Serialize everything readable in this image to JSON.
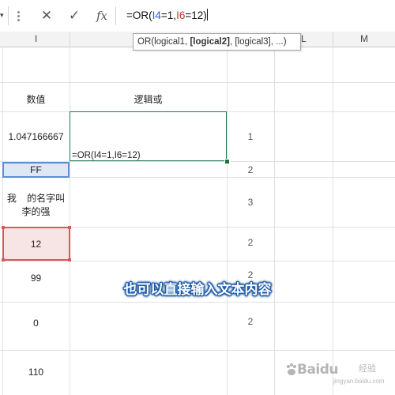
{
  "formula_bar": {
    "cancel_icon": "✕",
    "confirm_icon": "✓",
    "fx_label": "fx",
    "formula_parts": [
      "=OR(",
      "I4",
      "=1,",
      "I6",
      "=12)"
    ]
  },
  "columns": [
    "I",
    "L",
    "M"
  ],
  "tooltip": {
    "prefix": "OR(logical1, ",
    "bold": "[logical2]",
    "suffix": ", [logical3], ...)"
  },
  "cells": {
    "header_value": "数值",
    "header_logic": "逻辑或",
    "i4": "1.047166667",
    "i5": "FF",
    "i6_line1": "我    的名字叫",
    "i6_line2": "李的强",
    "i7": "12",
    "i8": "99",
    "i9": "0",
    "i10": "110",
    "formula_text": "=OR(I4=1,I6=12)",
    "k_values": [
      "1",
      "2",
      "3",
      "2",
      "2",
      "2"
    ]
  },
  "subtitle": "也可以直接输入文本内容",
  "watermark": {
    "brand": "Baidu",
    "sub": "经验",
    "url": "jingyan.baidu.com"
  },
  "colors": {
    "selection_green": "#217346",
    "ref_blue": "#2e5bd8",
    "ref_red": "#c3362b"
  }
}
